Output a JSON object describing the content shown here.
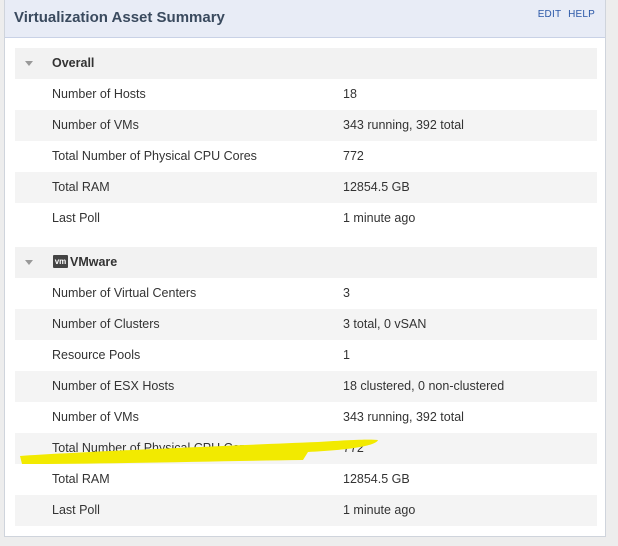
{
  "header": {
    "title": "Virtualization Asset Summary",
    "edit_label": "EDIT",
    "help_label": "HELP"
  },
  "overall": {
    "title": "Overall",
    "rows": [
      {
        "label": "Number of Hosts",
        "value": "18"
      },
      {
        "label": "Number of VMs",
        "value": "343 running, 392 total"
      },
      {
        "label": "Total Number of Physical CPU Cores",
        "value": "772"
      },
      {
        "label": "Total RAM",
        "value": "12854.5 GB"
      },
      {
        "label": "Last Poll",
        "value": "1 minute ago"
      }
    ]
  },
  "vmware": {
    "title": "VMware",
    "logo_text": "vm",
    "rows": [
      {
        "label": "Number of Virtual Centers",
        "value": "3"
      },
      {
        "label": "Number of Clusters",
        "value": "3 total, 0 vSAN"
      },
      {
        "label": "Resource Pools",
        "value": "1"
      },
      {
        "label": "Number of ESX Hosts",
        "value": "18 clustered, 0 non-clustered"
      },
      {
        "label": "Number of VMs",
        "value": "343 running, 392 total"
      },
      {
        "label": "Total Number of Physical CPU Cores",
        "value": "772"
      },
      {
        "label": "Total RAM",
        "value": "12854.5 GB"
      },
      {
        "label": "Last Poll",
        "value": "1 minute ago"
      }
    ]
  },
  "highlight_color": "#f2ea00"
}
